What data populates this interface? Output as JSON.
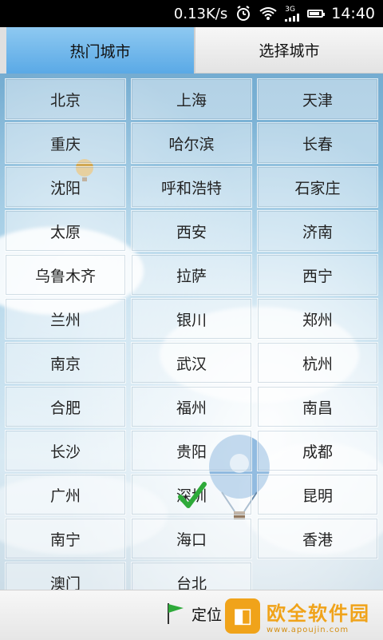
{
  "status_bar": {
    "net_speed": "0.13K/s",
    "network": "3G",
    "time": "14:40",
    "battery_level_percent": 85
  },
  "tabs": [
    {
      "label": "热门城市",
      "active": true
    },
    {
      "label": "选择城市",
      "active": false
    }
  ],
  "cities": [
    "北京",
    "上海",
    "天津",
    "重庆",
    "哈尔滨",
    "长春",
    "沈阳",
    "呼和浩特",
    "石家庄",
    "太原",
    "西安",
    "济南",
    "乌鲁木齐",
    "拉萨",
    "西宁",
    "兰州",
    "银川",
    "郑州",
    "南京",
    "武汉",
    "杭州",
    "合肥",
    "福州",
    "南昌",
    "长沙",
    "贵阳",
    "成都",
    "广州",
    "深圳",
    "昆明",
    "南宁",
    "海口",
    "香港",
    "澳门",
    "台北"
  ],
  "selected_city": "深圳",
  "bottom_bar": {
    "locate_label": "定位"
  },
  "watermark": {
    "title": "欧全软件园",
    "url": "www.apoujin.com"
  },
  "colors": {
    "tab_active": "#5aa9e6",
    "watermark": "#f0a31a",
    "check": "#2eaa3a"
  }
}
